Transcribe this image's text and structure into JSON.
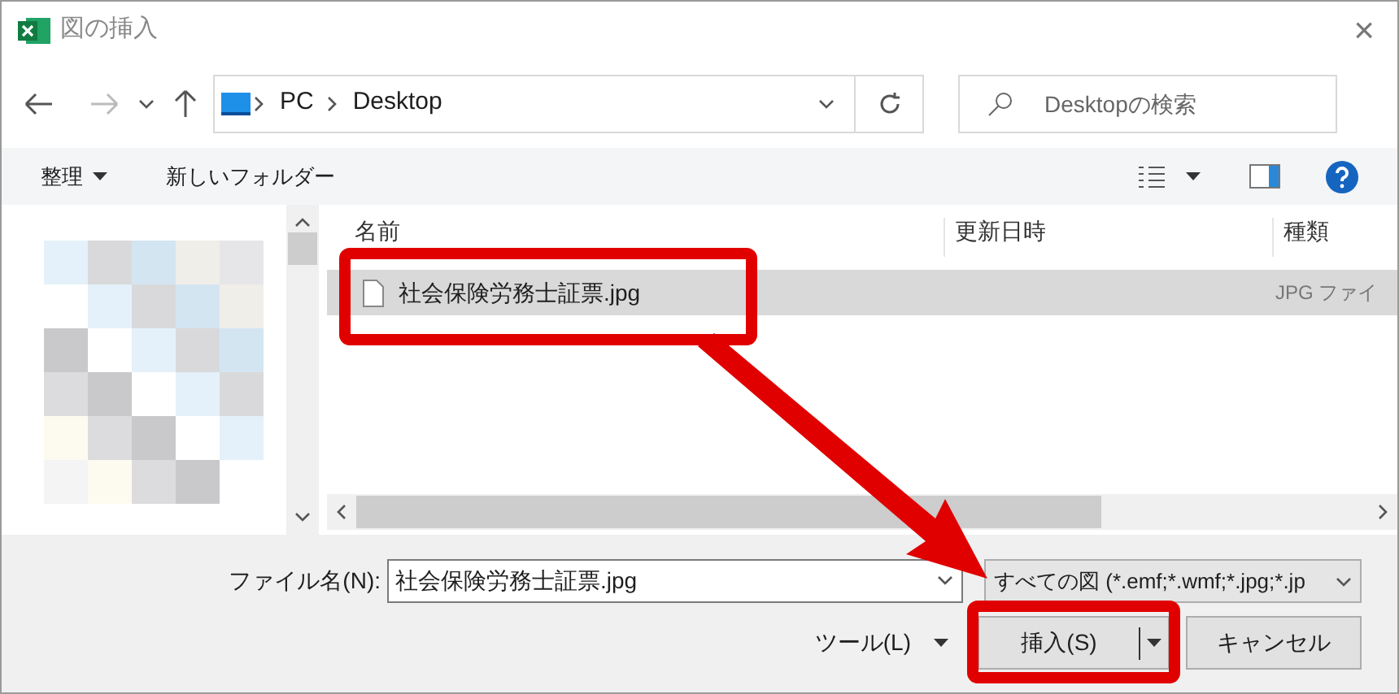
{
  "window": {
    "title": "図の挿入",
    "close": "×"
  },
  "address": {
    "crumbs": [
      "PC",
      "Desktop"
    ]
  },
  "search": {
    "placeholder": "Desktopの検索"
  },
  "toolbar": {
    "organize": "整理",
    "new_folder": "新しいフォルダー"
  },
  "columns": [
    "名前",
    "更新日時",
    "種類"
  ],
  "files": [
    {
      "name": "社会保険労務士証票.jpg",
      "type": "JPG ファイ",
      "selected": true
    }
  ],
  "footer": {
    "filename_label": "ファイル名(N):",
    "filename_value": "社会保険労務士証票.jpg",
    "filter": "すべての図 (*.emf;*.wmf;*.jpg;*.jp",
    "tools": "ツール(L)",
    "insert": "挿入(S)",
    "cancel": "キャンセル"
  },
  "annotations": [
    {
      "kind": "frame"
    },
    {
      "kind": "arrow"
    },
    {
      "kind": "frame"
    }
  ]
}
